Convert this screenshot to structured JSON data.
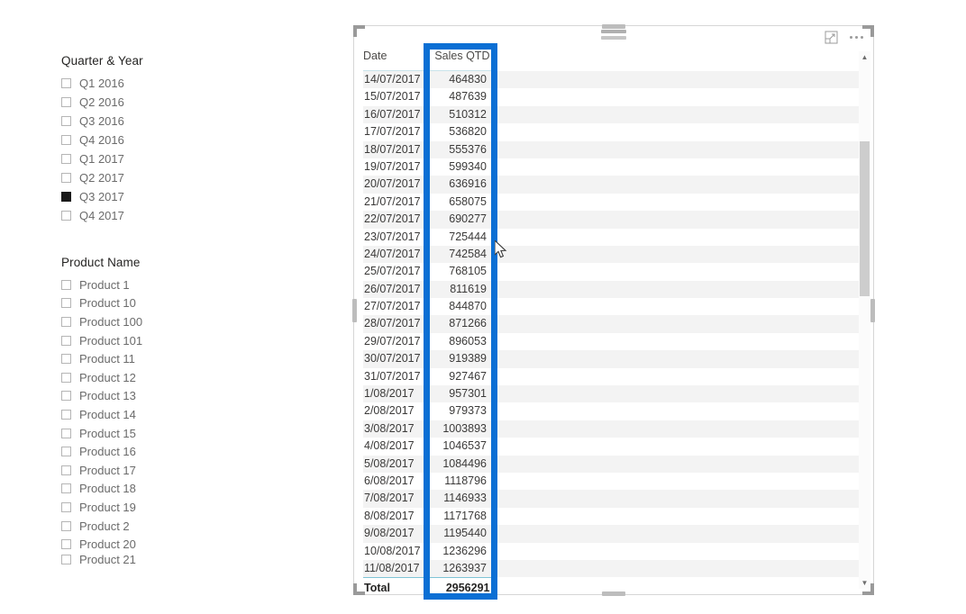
{
  "slicers": [
    {
      "name": "quarter-year",
      "title": "Quarter & Year",
      "items": [
        {
          "label": "Q1 2016",
          "checked": false
        },
        {
          "label": "Q2 2016",
          "checked": false
        },
        {
          "label": "Q3 2016",
          "checked": false
        },
        {
          "label": "Q4 2016",
          "checked": false
        },
        {
          "label": "Q1 2017",
          "checked": false
        },
        {
          "label": "Q2 2017",
          "checked": false
        },
        {
          "label": "Q3 2017",
          "checked": true
        },
        {
          "label": "Q4 2017",
          "checked": false
        }
      ]
    },
    {
      "name": "product-name",
      "title": "Product Name",
      "items": [
        {
          "label": "Product 1",
          "checked": false
        },
        {
          "label": "Product 10",
          "checked": false
        },
        {
          "label": "Product 100",
          "checked": false
        },
        {
          "label": "Product 101",
          "checked": false
        },
        {
          "label": "Product 11",
          "checked": false
        },
        {
          "label": "Product 12",
          "checked": false
        },
        {
          "label": "Product 13",
          "checked": false
        },
        {
          "label": "Product 14",
          "checked": false
        },
        {
          "label": "Product 15",
          "checked": false
        },
        {
          "label": "Product 16",
          "checked": false
        },
        {
          "label": "Product 17",
          "checked": false
        },
        {
          "label": "Product 18",
          "checked": false
        },
        {
          "label": "Product 19",
          "checked": false
        },
        {
          "label": "Product 2",
          "checked": false
        },
        {
          "label": "Product 20",
          "checked": false
        },
        {
          "label": "Product 21",
          "checked": false
        }
      ]
    }
  ],
  "visual": {
    "icons": {
      "focus_mode": "focus-mode-icon",
      "more_options": "more-options-icon",
      "drag_grip": "drag-handle-icon",
      "scroll_up": "▲",
      "scroll_down": "▼"
    }
  },
  "table": {
    "columns": [
      "Date",
      "Sales QTD"
    ],
    "rows": [
      [
        "14/07/2017",
        "464830"
      ],
      [
        "15/07/2017",
        "487639"
      ],
      [
        "16/07/2017",
        "510312"
      ],
      [
        "17/07/2017",
        "536820"
      ],
      [
        "18/07/2017",
        "555376"
      ],
      [
        "19/07/2017",
        "599340"
      ],
      [
        "20/07/2017",
        "636916"
      ],
      [
        "21/07/2017",
        "658075"
      ],
      [
        "22/07/2017",
        "690277"
      ],
      [
        "23/07/2017",
        "725444"
      ],
      [
        "24/07/2017",
        "742584"
      ],
      [
        "25/07/2017",
        "768105"
      ],
      [
        "26/07/2017",
        "811619"
      ],
      [
        "27/07/2017",
        "844870"
      ],
      [
        "28/07/2017",
        "871266"
      ],
      [
        "29/07/2017",
        "896053"
      ],
      [
        "30/07/2017",
        "919389"
      ],
      [
        "31/07/2017",
        "927467"
      ],
      [
        "1/08/2017",
        "957301"
      ],
      [
        "2/08/2017",
        "979373"
      ],
      [
        "3/08/2017",
        "1003893"
      ],
      [
        "4/08/2017",
        "1046537"
      ],
      [
        "5/08/2017",
        "1084496"
      ],
      [
        "6/08/2017",
        "1118796"
      ],
      [
        "7/08/2017",
        "1146933"
      ],
      [
        "8/08/2017",
        "1171768"
      ],
      [
        "9/08/2017",
        "1195440"
      ],
      [
        "10/08/2017",
        "1236296"
      ],
      [
        "11/08/2017",
        "1263937"
      ]
    ],
    "total": {
      "label": "Total",
      "value": "2956291"
    }
  },
  "annotation": {
    "name": "sales-qtd-column-highlight",
    "color": "#0b6fd4"
  },
  "colors": {
    "accent": "#0b6fd4",
    "row_band": "#f3f3f3",
    "header_rule": "#c9e3ea",
    "total_rule": "#7fc4d6",
    "text": "#3b3a39",
    "muted_text": "#6b6b6b"
  }
}
